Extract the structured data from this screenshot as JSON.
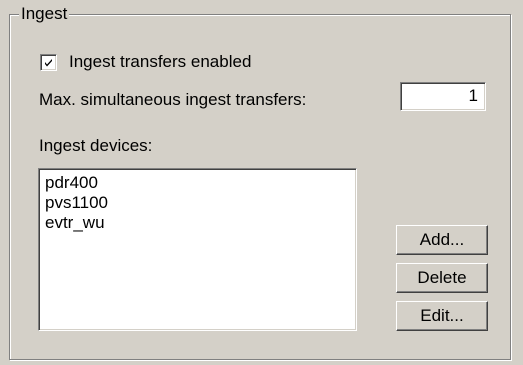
{
  "group": {
    "title": "Ingest"
  },
  "ingest_enabled": {
    "label": "Ingest transfers enabled",
    "checked": true
  },
  "max_transfers": {
    "label": "Max. simultaneous ingest transfers:",
    "value": "1"
  },
  "devices": {
    "label": "Ingest devices:",
    "items": [
      "pdr400",
      "pvs1100",
      "evtr_wu"
    ]
  },
  "buttons": {
    "add": "Add...",
    "delete": "Delete",
    "edit": "Edit..."
  }
}
